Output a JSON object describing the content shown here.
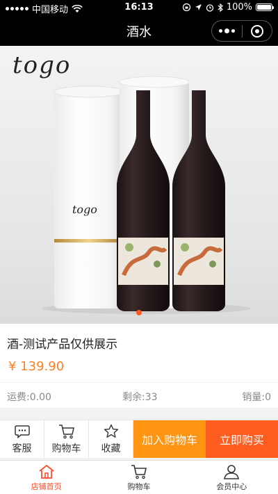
{
  "status_bar": {
    "carrier": "中国移动",
    "time": "16:13",
    "battery": "100%"
  },
  "nav": {
    "title": "酒水"
  },
  "hero": {
    "logo_text": "togo",
    "tube_logo_text": "togo",
    "slide_count": 1,
    "active_slide": 1
  },
  "product": {
    "title": "酒-测试产品仅供展示",
    "price": "¥ 139.90",
    "shipping": "运费:0.00",
    "stock": "剩余:33",
    "sales": "销量:0"
  },
  "actions": {
    "service": "客服",
    "cart": "购物车",
    "favorite": "收藏",
    "add_to_cart": "加入购物车",
    "buy_now": "立即购买"
  },
  "tabs": [
    {
      "label": "店铺首页",
      "icon": "home-icon",
      "active": true
    },
    {
      "label": "购物车",
      "icon": "cart-icon",
      "active": false
    },
    {
      "label": "会员中心",
      "icon": "user-icon",
      "active": false
    }
  ],
  "colors": {
    "accent": "#ff5c1f",
    "cart_button": "#ff9512",
    "price": "#ff7f24",
    "active_tab": "#ff4b2b"
  }
}
